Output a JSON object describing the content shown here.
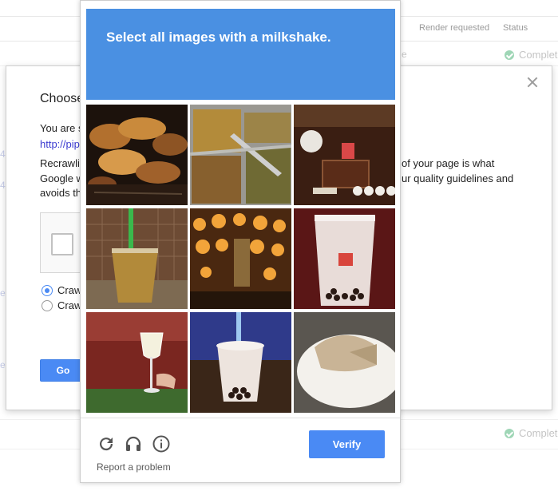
{
  "background": {
    "columns": [
      "Render requested",
      "Status"
    ],
    "status_rows": [
      {
        "status": "Complete"
      },
      {
        "status": "Complete"
      }
    ],
    "fragments": [
      "e",
      "4",
      "4",
      "e",
      "e"
    ]
  },
  "choose_dialog": {
    "title": "Choose",
    "line1": "You are s",
    "link": "http://pip",
    "line2_left": "Recrawli",
    "line2_right": "of your page is what",
    "line3_left": "Google w",
    "line3_right": "ur quality guidelines and",
    "line4_left": "avoids th",
    "radio_1_label": "Craw",
    "radio_2_label": "Craw",
    "go_label": "Go"
  },
  "captcha": {
    "title": "Select all images with a milkshake.",
    "tiles": [
      {
        "name": "tile-grilled-food"
      },
      {
        "name": "tile-food-trays"
      },
      {
        "name": "tile-restaurant-table"
      },
      {
        "name": "tile-iced-drink-green-straw"
      },
      {
        "name": "tile-blurry-lights"
      },
      {
        "name": "tile-bubble-tea"
      },
      {
        "name": "tile-wine-glass"
      },
      {
        "name": "tile-bubble-tea-blue-straw"
      },
      {
        "name": "tile-wrap-on-plate"
      }
    ],
    "icons": [
      "reload-icon",
      "audio-icon",
      "info-icon"
    ],
    "report_label": "Report a problem",
    "verify_label": "Verify",
    "colors": {
      "header": "#4a90e2",
      "verify": "#4a8af4"
    }
  }
}
